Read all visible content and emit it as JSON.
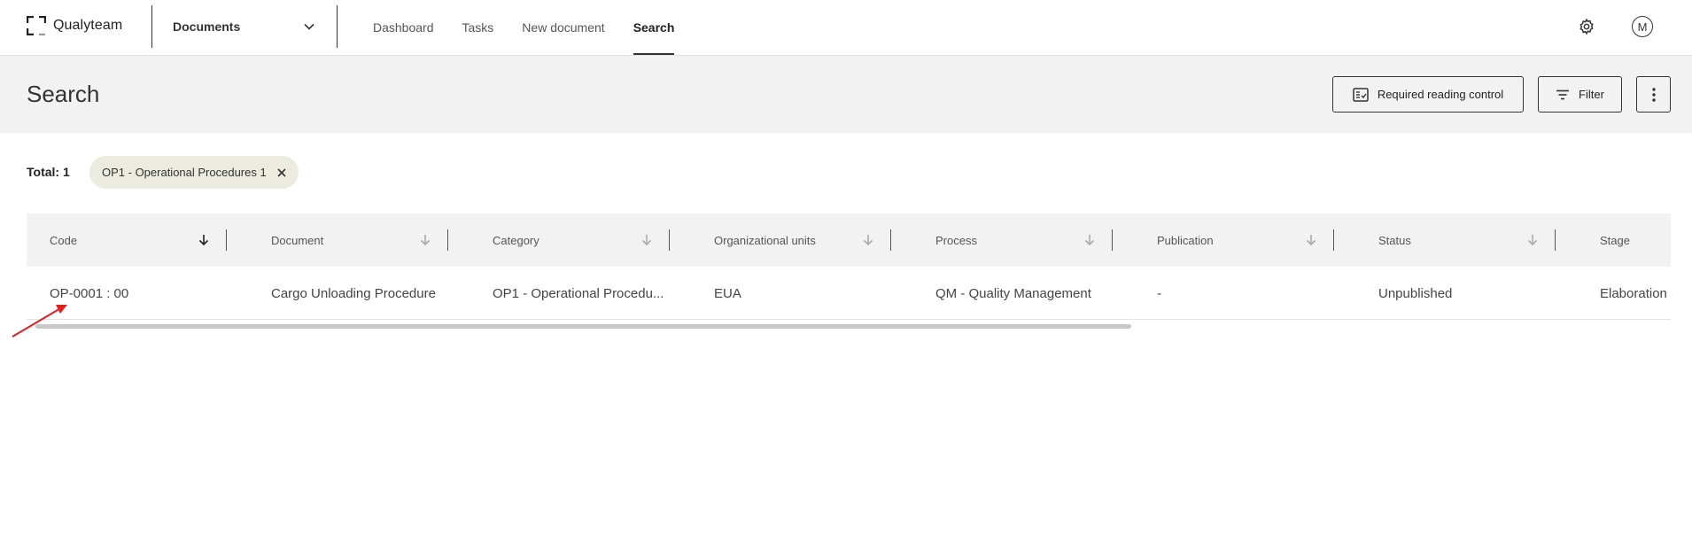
{
  "app": {
    "name": "Qualyteam"
  },
  "module_selector": {
    "label": "Documents"
  },
  "nav": {
    "items": [
      {
        "label": "Dashboard"
      },
      {
        "label": "Tasks"
      },
      {
        "label": "New document"
      },
      {
        "label": "Search"
      }
    ]
  },
  "user": {
    "initial": "M"
  },
  "page": {
    "title": "Search"
  },
  "actions": {
    "required_reading": "Required reading control",
    "filter": "Filter"
  },
  "filters": {
    "total_label": "Total: 1",
    "chip_label": "OP1 - Operational Procedures 1"
  },
  "table": {
    "columns": [
      "Code",
      "Document",
      "Category",
      "Organizational units",
      "Process",
      "Publication",
      "Status",
      "Stage"
    ],
    "rows": [
      [
        "OP-0001 : 00",
        "Cargo Unloading Procedure",
        "OP1 - Operational Procedu...",
        "EUA",
        "QM - Quality Management",
        "-",
        "Unpublished",
        "Elaboration"
      ]
    ]
  },
  "icons": {
    "settings": "gear-icon",
    "more": "vertical-dots-icon",
    "filter": "filter-lines-icon",
    "reading": "checklist-icon",
    "close": "close-icon",
    "sort": "arrow-down-icon"
  },
  "colors": {
    "accent": "#333333",
    "header_band": "#f2f2f2",
    "chip": "#ebebdf",
    "annotation": "#e02020"
  }
}
